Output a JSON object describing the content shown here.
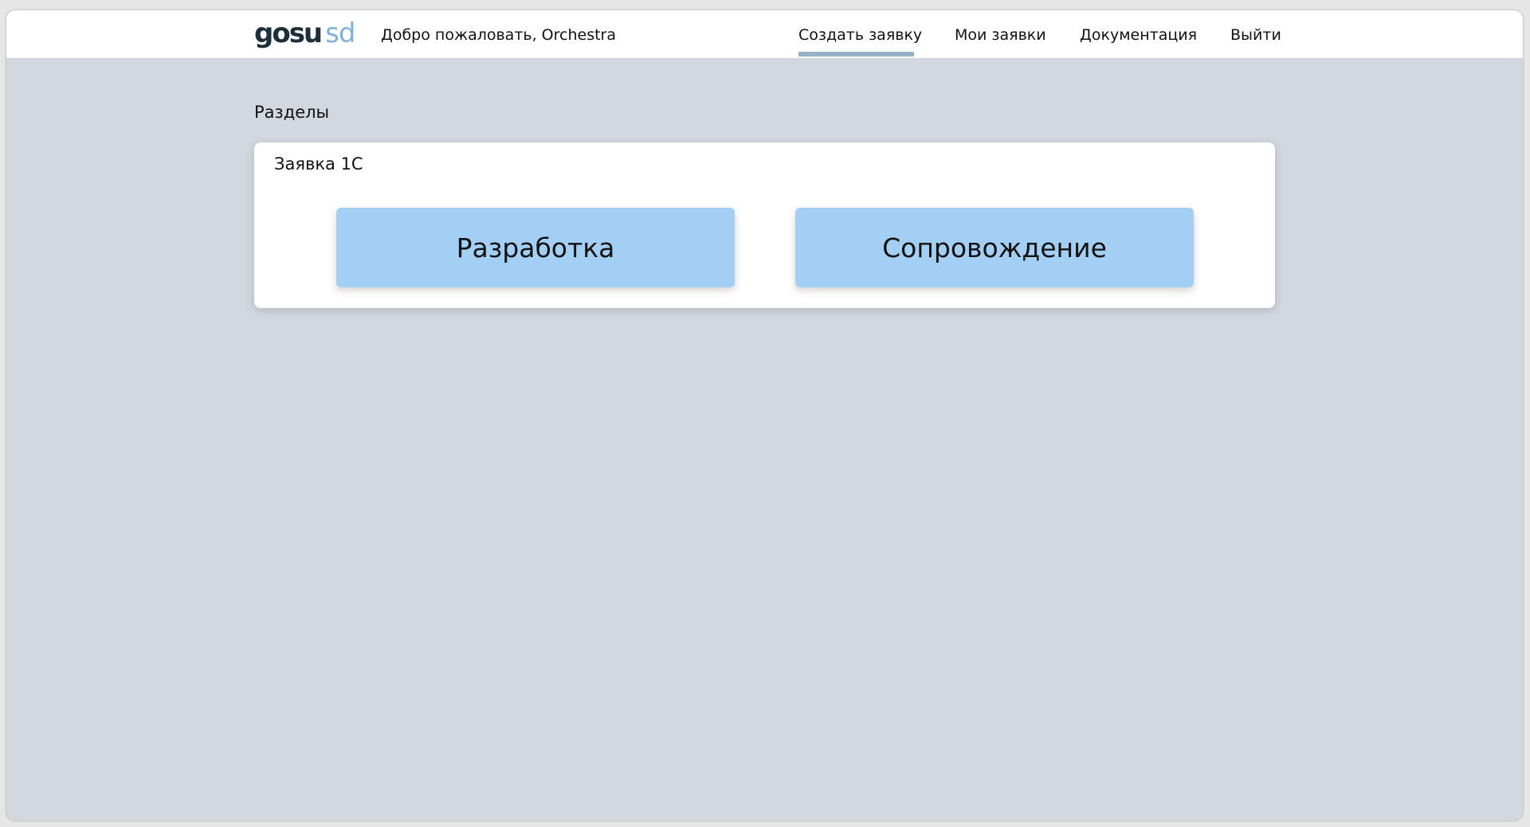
{
  "header": {
    "logo": {
      "part1": "gosu",
      "part2": "sd"
    },
    "welcome_text": "Добро пожаловать, Orchestra",
    "nav": {
      "create_request": "Создать заявку",
      "my_requests": "Мои заявки",
      "documentation": "Документация",
      "logout": "Выйти"
    },
    "active_nav": "create_request"
  },
  "main": {
    "section_heading": "Разделы",
    "card": {
      "title": "Заявка 1С",
      "tiles": {
        "development": "Разработка",
        "support": "Сопровождение"
      }
    }
  },
  "colors": {
    "background": "#d3d8e0",
    "tile": "#a4cff4",
    "active_underline": "#98b1c4",
    "logo_dark": "#1e2f3a",
    "logo_light": "#7fb1d9"
  }
}
